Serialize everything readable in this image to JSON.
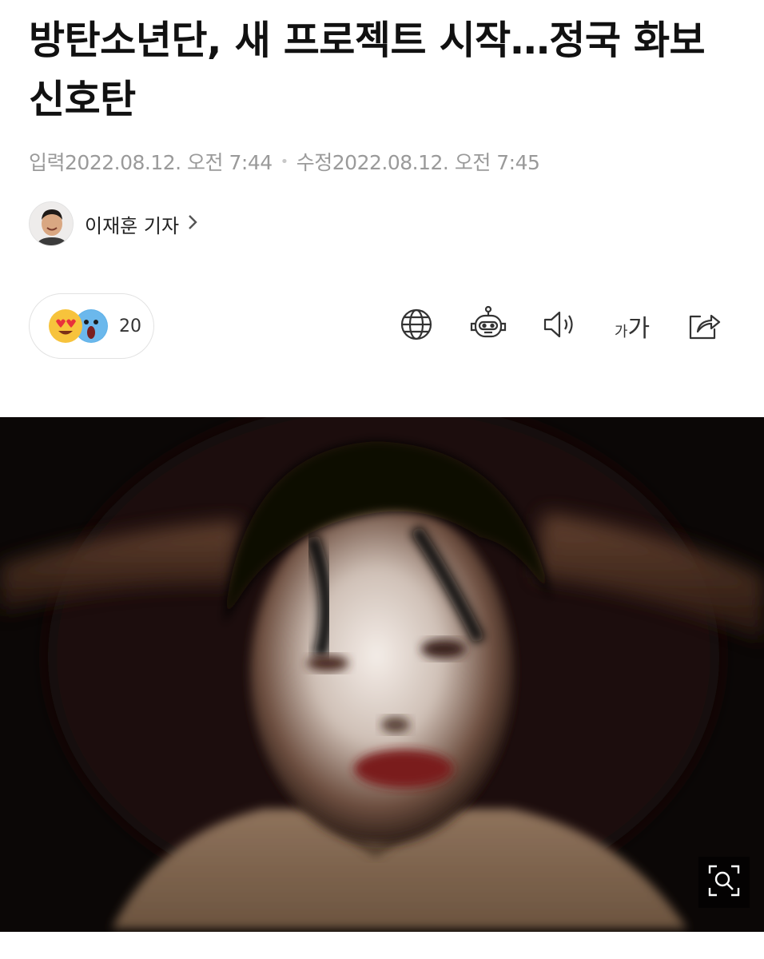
{
  "article": {
    "title": "방탄소년단, 새 프로젝트 시작…정국 화보 신호탄",
    "published_label": "입력",
    "published_time": "2022.08.12. 오전 7:44",
    "modified_label": "수정",
    "modified_time": "2022.08.12. 오전 7:45"
  },
  "reporter": {
    "name": "이재훈 기자"
  },
  "reactions": {
    "count": "20",
    "emojis": [
      "heart-eyes-emoji",
      "screaming-emoji"
    ]
  },
  "toolbar": {
    "icons": [
      "globe-icon",
      "robot-icon",
      "speaker-icon",
      "font-size-icon",
      "share-icon"
    ],
    "font_small": "가",
    "font_large": "가"
  },
  "photo": {
    "zoom_icon": "zoom-icon"
  }
}
